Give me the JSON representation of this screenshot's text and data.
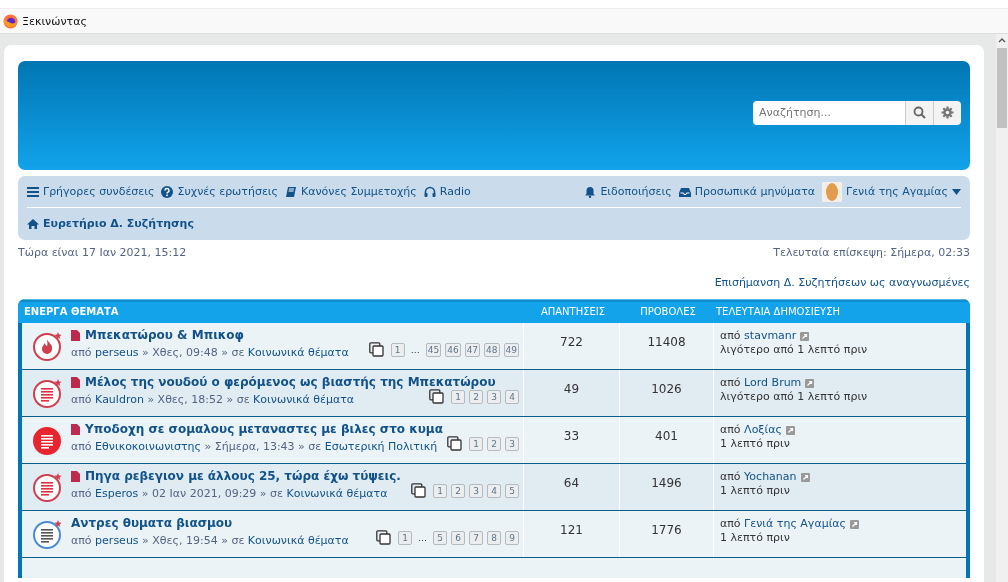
{
  "bookmarks_bar": {
    "items": [
      {
        "label": "Ξεκινώντας"
      }
    ]
  },
  "header": {
    "search": {
      "placeholder": "Αναζήτηση..."
    }
  },
  "navbar": {
    "left_links": [
      {
        "label": "Γρήγορες συνδέσεις",
        "kind": "menu"
      },
      {
        "label": "Συχνές ερωτήσεις",
        "kind": "faq"
      },
      {
        "label": "Κανόνες Συμμετοχής",
        "kind": "rules"
      },
      {
        "label": "Radio",
        "kind": "radio"
      }
    ],
    "right_links": [
      {
        "label": "Ειδοποιήσεις",
        "kind": "notifications"
      },
      {
        "label": "Προσωπικά μηνύματα",
        "kind": "messages"
      },
      {
        "label": "Γενιά της Αγαμίας",
        "kind": "user"
      }
    ],
    "breadcrumb": "Ευρετήριο Δ. Συζήτησης"
  },
  "current_time": "Τώρα είναι 17 Ιαν 2021, 15:12",
  "last_visit": "Τελευταία επίσκεψη: Σήμερα, 02:33",
  "mark_read_link": "Επισήμανση Δ. Συζητήσεων ως αναγνωσμένες",
  "table": {
    "columns": [
      "ΕΝΕΡΓΑ ΘΕΜΑΤΑ",
      "ΑΠΑΝΤΗΣΕΙΣ",
      "ΠΡΟΒΟΛΕΣ",
      "ΤΕΛΕΥΤΑΙΑ ΔΗΜΟΣΙΕΥΣΗ"
    ],
    "rows": [
      {
        "kind": "hot",
        "starred": true,
        "new_posts": true,
        "title": "Μπεκατώρου & Μπικοφ",
        "meta": [
          {
            "text": "από",
            "kind": "plain"
          },
          {
            "text": "perseus",
            "kind": "link"
          },
          {
            "text": "» Χθες, 09:48 » σε",
            "kind": "plain"
          },
          {
            "text": "Κοινωνικά θέματα",
            "kind": "link"
          }
        ],
        "pages": [
          "1",
          "…",
          "45",
          "46",
          "47",
          "48",
          "49"
        ],
        "replies": "722",
        "views": "11408",
        "last_by": "από",
        "last_user": "stavmanr",
        "last_time": "λιγότερο από 1 λεπτό πριν"
      },
      {
        "kind": "topic",
        "starred": true,
        "new_posts": true,
        "title": "Μέλος της νουδού ο φερόμενος ως βιαστής της Μπεκατώρου",
        "meta": [
          {
            "text": "από",
            "kind": "plain"
          },
          {
            "text": "Kauldron",
            "kind": "link"
          },
          {
            "text": "» Χθες, 18:52 » σε",
            "kind": "plain"
          },
          {
            "text": "Κοινωνικά θέματα",
            "kind": "link"
          }
        ],
        "pages": [
          "1",
          "2",
          "3",
          "4"
        ],
        "replies": "49",
        "views": "1026",
        "last_by": "από",
        "last_user": "Lord Brum",
        "last_time": "λιγότερο από 1 λεπτό πριν"
      },
      {
        "kind": "own",
        "starred": false,
        "new_posts": true,
        "title": "Υποδοχη σε σομαλους μεταναστες με βιλες στο κυμα",
        "meta": [
          {
            "text": "από",
            "kind": "plain"
          },
          {
            "text": "Εθνικοκοινωνιστης",
            "kind": "link"
          },
          {
            "text": "» Σήμερα, 13:43 » σε",
            "kind": "plain"
          },
          {
            "text": "Εσωτερική Πολιτική",
            "kind": "link"
          }
        ],
        "pages": [
          "1",
          "2",
          "3"
        ],
        "replies": "33",
        "views": "401",
        "last_by": "από",
        "last_user": "Λοξίας",
        "last_time": "1 λεπτό πριν"
      },
      {
        "kind": "topic",
        "starred": true,
        "new_posts": true,
        "title": "Πηγα ρεβεγιον με άλλους 25, τώρα έχω τύψεις.",
        "meta": [
          {
            "text": "από",
            "kind": "plain"
          },
          {
            "text": "Esperos",
            "kind": "link"
          },
          {
            "text": "» 02 Ιαν 2021, 09:29 » σε",
            "kind": "plain"
          },
          {
            "text": "Κοινωνικά θέματα",
            "kind": "link"
          }
        ],
        "pages": [
          "1",
          "2",
          "3",
          "4",
          "5"
        ],
        "replies": "64",
        "views": "1496",
        "last_by": "από",
        "last_user": "Yochanan",
        "last_time": "1 λεπτό πριν"
      },
      {
        "kind": "read",
        "starred": true,
        "new_posts": false,
        "title": "Αντρες θυματα βιασμου",
        "meta": [
          {
            "text": "από",
            "kind": "plain"
          },
          {
            "text": "perseus",
            "kind": "link"
          },
          {
            "text": "» Χθες, 19:54 » σε",
            "kind": "plain"
          },
          {
            "text": "Κοινωνικά θέματα",
            "kind": "link"
          }
        ],
        "pages": [
          "1",
          "…",
          "5",
          "6",
          "7",
          "8",
          "9"
        ],
        "replies": "121",
        "views": "1776",
        "last_by": "από",
        "last_user": "Γενιά της Αγαμίας",
        "last_time": "1 λεπτό πριν"
      }
    ]
  }
}
